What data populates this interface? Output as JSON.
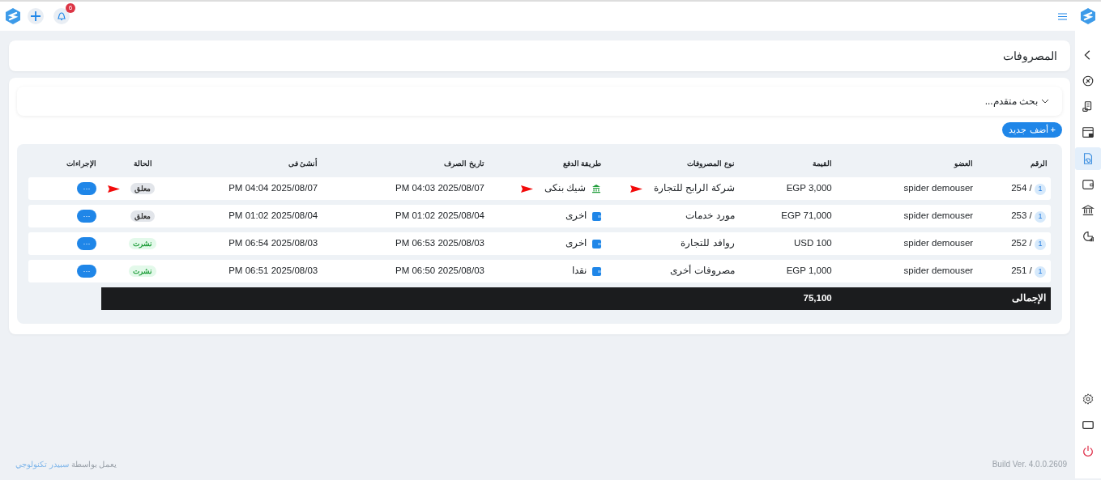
{
  "top_bar": {
    "notification_count": "6"
  },
  "sidebar": {
    "items": [
      {
        "selected": false
      },
      {
        "selected": false
      },
      {
        "selected": false
      },
      {
        "selected": false
      },
      {
        "selected": true
      },
      {
        "selected": false
      },
      {
        "selected": false
      },
      {
        "selected": false
      }
    ]
  },
  "page_title": "المصروفات",
  "advanced_search": {
    "label": "بحث متقدم...",
    "expanded": false
  },
  "add_button": {
    "icon": "+",
    "label": "أضف جديد"
  },
  "table": {
    "columns": [
      "الرقم",
      "العضو",
      "القيمة",
      "نوع المصروفات",
      "طريقة الدفع",
      "تاريخ الصرف",
      "أنشئ فى",
      "الحالة",
      "الإجراءات"
    ],
    "rows": [
      {
        "count": "1",
        "separator": "/",
        "number": "254",
        "member": "spider demouser",
        "amount": "EGP 3,000",
        "expense_type": "شركة الرابح للتجارة",
        "payment": {
          "kind": "bank",
          "label": "شيك بنكى"
        },
        "spent_at": "2025/08/07 04:03 PM",
        "created_at": "2025/08/07 04:04 PM",
        "status": {
          "kind": "pending",
          "label": "معلق"
        },
        "flagged": true,
        "action": "···"
      },
      {
        "count": "1",
        "separator": "/",
        "number": "253",
        "member": "spider demouser",
        "amount": "EGP 71,000",
        "expense_type": "مورد خدمات",
        "payment": {
          "kind": "wallet",
          "label": "اخرى"
        },
        "spent_at": "2025/08/04 01:02 PM",
        "created_at": "2025/08/04 01:02 PM",
        "status": {
          "kind": "pending",
          "label": "معلق"
        },
        "flagged": false,
        "action": "···"
      },
      {
        "count": "1",
        "separator": "/",
        "number": "252",
        "member": "spider demouser",
        "amount": "USD 100",
        "expense_type": "روافد للتجارة",
        "payment": {
          "kind": "wallet",
          "label": "اخرى"
        },
        "spent_at": "2025/08/03 06:53 PM",
        "created_at": "2025/08/03 06:54 PM",
        "status": {
          "kind": "published",
          "label": "نشرت"
        },
        "flagged": false,
        "action": "···"
      },
      {
        "count": "1",
        "separator": "/",
        "number": "251",
        "member": "spider demouser",
        "amount": "EGP 1,000",
        "expense_type": "مصروفات أخرى",
        "payment": {
          "kind": "wallet",
          "label": "نقدا"
        },
        "spent_at": "2025/08/03 06:50 PM",
        "created_at": "2025/08/03 06:51 PM",
        "status": {
          "kind": "published",
          "label": "نشرت"
        },
        "flagged": false,
        "action": "···"
      }
    ],
    "total": {
      "label": "الإجمالى",
      "amount": "75,100"
    }
  },
  "footer": {
    "powered_by": "يعمل بواسطة",
    "company": "سبيدر تكنولوجي",
    "build": "Build Ver. 4.0.0.2609"
  }
}
